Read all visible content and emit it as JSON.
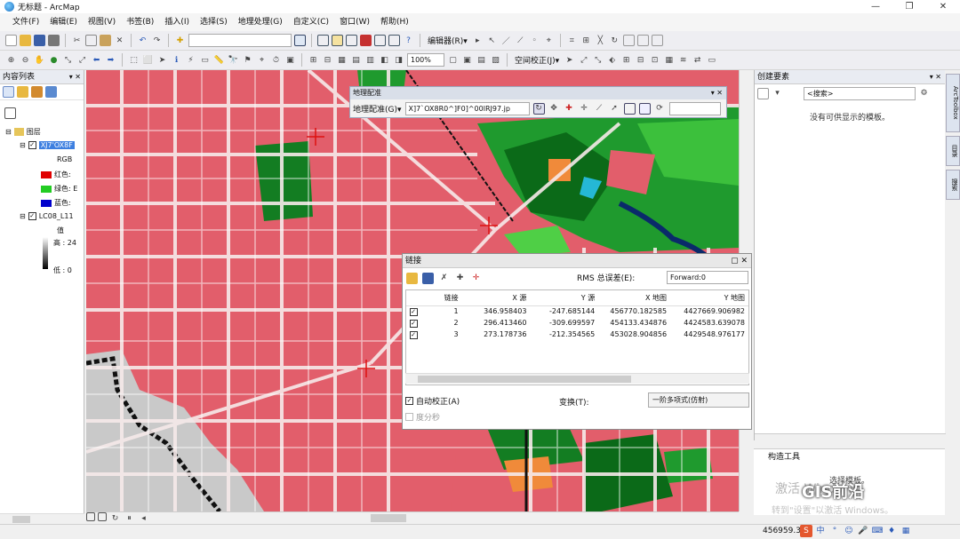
{
  "window": {
    "title": "无标题 - ArcMap",
    "controls": [
      "—",
      "❐",
      "✕"
    ]
  },
  "menu": [
    "文件(F)",
    "编辑(E)",
    "视图(V)",
    "书签(B)",
    "插入(I)",
    "选择(S)",
    "地理处理(G)",
    "自定义(C)",
    "窗口(W)",
    "帮助(H)"
  ],
  "toolbar": {
    "editor_label": "编辑器(R)▾",
    "zoom_value": "100%",
    "spatial_adjust_label": "空间校正(J)▾"
  },
  "toc": {
    "title": "内容列表",
    "root": "图层",
    "layer1": {
      "name": "XJ7'OX8F",
      "band": "RGB",
      "red": "红色:",
      "green": "绿色: E",
      "blue": "蓝色:"
    },
    "layer2": {
      "name": "LC08_L11",
      "value": "值",
      "high": "高 : 24",
      "low": "低 : 0"
    },
    "colors": {
      "red": "#e00000",
      "green": "#22cc22",
      "blue": "#0000cc"
    }
  },
  "georef": {
    "title": "地理配准",
    "menu_label": "地理配准(G)▾",
    "layer_value": "X]7`OX8R0^]F0]^00lRJ97.jp"
  },
  "links": {
    "title": "链接",
    "rms_label": "RMS 总误差(E):",
    "rms_value": "Forward:0",
    "columns": [
      "链接",
      "X 源",
      "Y 源",
      "X 地图",
      "Y 地图"
    ],
    "rows": [
      [
        "1",
        "346.958403",
        "-247.685144",
        "456770.182585",
        "4427669.906982"
      ],
      [
        "2",
        "296.413460",
        "-309.699597",
        "454133.434876",
        "4424583.639078"
      ],
      [
        "3",
        "273.178736",
        "-212.354565",
        "453028.904856",
        "4429548.976177"
      ]
    ],
    "auto_adjust_label": "自动校正(A)",
    "dms_label": "度分秒",
    "transform_label": "变换(T):",
    "transform_value": "一阶多项式(仿射)"
  },
  "create_features": {
    "title": "创建要素",
    "search_placeholder": "<搜索>",
    "empty_text": "没有可供显示的模板。"
  },
  "construct_tools": {
    "title": "构造工具",
    "hint": "选择模板。"
  },
  "side_tabs": [
    "ArcToolbox",
    "目录",
    "搜索"
  ],
  "status": {
    "coords": "456959.3"
  },
  "watermark": {
    "line1": "激活 Windows",
    "line2": "转到\"设置\"以激活 Windows。",
    "brand": "GIS前沿"
  }
}
